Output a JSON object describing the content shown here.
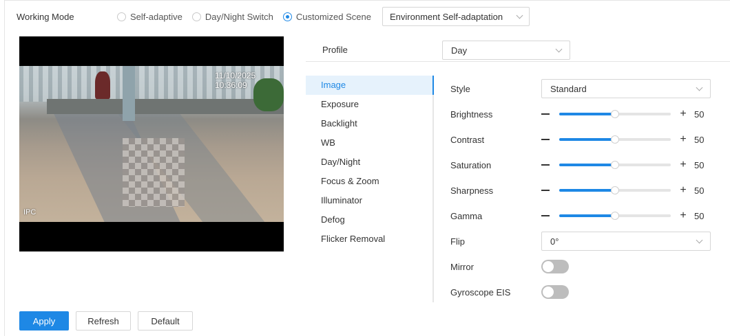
{
  "working_mode": {
    "label": "Working Mode",
    "options": [
      "Self-adaptive",
      "Day/Night Switch",
      "Customized Scene"
    ],
    "selected": "Customized Scene",
    "scene_select": "Environment Self-adaptation"
  },
  "video": {
    "timestamp": "11/10/2025 10:36:09",
    "channel_name": "IPC"
  },
  "profile": {
    "label": "Profile",
    "value": "Day"
  },
  "menu": {
    "items": [
      "Image",
      "Exposure",
      "Backlight",
      "WB",
      "Day/Night",
      "Focus & Zoom",
      "Illuminator",
      "Defog",
      "Flicker Removal"
    ],
    "active": "Image"
  },
  "image_settings": {
    "style": {
      "label": "Style",
      "value": "Standard"
    },
    "brightness": {
      "label": "Brightness",
      "value": "50",
      "fraction": 0.5
    },
    "contrast": {
      "label": "Contrast",
      "value": "50",
      "fraction": 0.5
    },
    "saturation": {
      "label": "Saturation",
      "value": "50",
      "fraction": 0.5
    },
    "sharpness": {
      "label": "Sharpness",
      "value": "50",
      "fraction": 0.5
    },
    "gamma": {
      "label": "Gamma",
      "value": "50",
      "fraction": 0.5
    },
    "flip": {
      "label": "Flip",
      "value": "0°"
    },
    "mirror": {
      "label": "Mirror",
      "on": false
    },
    "gyroscope_eis": {
      "label": "Gyroscope EIS",
      "on": false
    }
  },
  "buttons": {
    "apply": "Apply",
    "refresh": "Refresh",
    "default": "Default"
  },
  "colors": {
    "accent": "#1e88e5",
    "toggle_off": "#bdbdbd"
  }
}
